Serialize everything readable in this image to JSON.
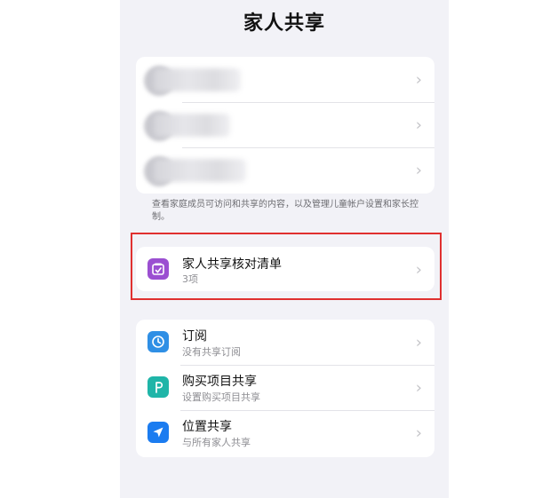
{
  "page": {
    "title": "家人共享"
  },
  "members": {
    "items": [
      {
        "name_hidden": true
      },
      {
        "name_hidden": true
      },
      {
        "name_hidden": true
      }
    ]
  },
  "footnote": "查看家庭成员可访问和共享的内容，以及管理儿童帐户设置和家长控制。",
  "checklist": {
    "title": "家人共享核对清单",
    "subtitle": "3项",
    "icon": "checklist-icon",
    "icon_color": "#9b4fd1"
  },
  "services": [
    {
      "title": "订阅",
      "subtitle": "没有共享订阅",
      "icon": "subscription-icon",
      "icon_color": "#2f8fe5"
    },
    {
      "title": "购买项目共享",
      "subtitle": "设置购买项目共享",
      "icon": "purchase-sharing-icon",
      "icon_color": "#1fb5a8"
    },
    {
      "title": "位置共享",
      "subtitle": "与所有家人共享",
      "icon": "location-arrow-icon",
      "icon_color": "#1b7cf0"
    }
  ],
  "chevron": "›",
  "colors": {
    "background": "#f2f2f7",
    "card": "#ffffff",
    "highlight": "#e0302f"
  }
}
